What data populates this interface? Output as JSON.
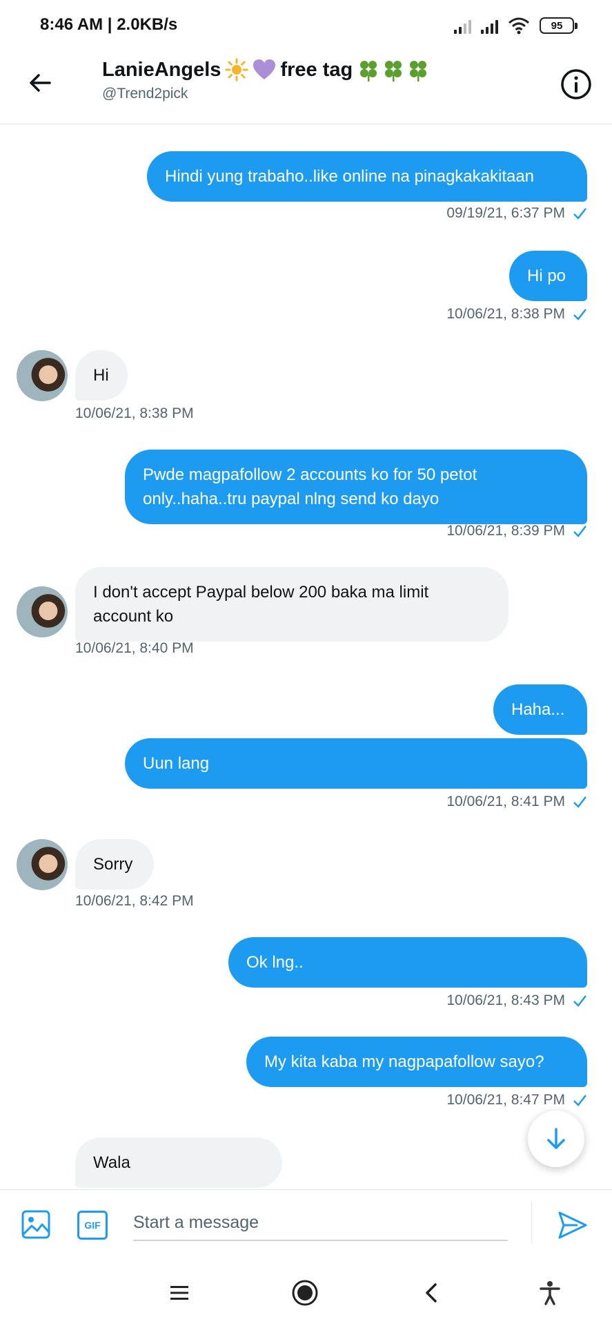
{
  "status_bar": {
    "time": "8:46 AM",
    "net_speed": "2.0KB/s",
    "battery": "95"
  },
  "header": {
    "name": "LanieAngels",
    "name_suffix": "free tag",
    "handle": "@Trend2pick"
  },
  "messages": [
    {
      "dir": "sent",
      "text": "Hindi yung trabaho..like online na pinagkakakitaan",
      "time": "09/19/21, 6:37 PM"
    },
    {
      "dir": "sent",
      "text": "Hi po",
      "time": "10/06/21, 8:38 PM"
    },
    {
      "dir": "recv",
      "text": "Hi",
      "time": "10/06/21, 8:38 PM"
    },
    {
      "dir": "sent",
      "text": "Pwde magpafollow 2 accounts ko for 50 petot only..haha..tru paypal nlng send ko dayo",
      "time": "10/06/21, 8:39 PM"
    },
    {
      "dir": "recv",
      "text": "I don't accept Paypal below 200 baka ma limit account ko",
      "time": "10/06/21, 8:40 PM"
    },
    {
      "dir": "sent",
      "text": "Haha..."
    },
    {
      "dir": "sent",
      "text": "Uun lang",
      "time": "10/06/21, 8:41 PM"
    },
    {
      "dir": "recv",
      "text": "Sorry",
      "time": "10/06/21, 8:42 PM"
    },
    {
      "dir": "sent",
      "text": "Ok lng..",
      "time": "10/06/21, 8:43 PM"
    },
    {
      "dir": "sent",
      "text": "My kita kaba my nagpapafollow sayo?",
      "time": "10/06/21, 8:47 PM"
    },
    {
      "dir": "recv",
      "text": "Wala"
    }
  ],
  "composer": {
    "placeholder": "Start a message",
    "gif_label": "GIF"
  },
  "colors": {
    "accent": "#1d9bf0",
    "received_bubble": "#eff3f4",
    "secondary_text": "#536471"
  },
  "icons": [
    "back-arrow-icon",
    "info-icon",
    "star-icon",
    "purple-heart-icon",
    "four-leaf-clover-icon",
    "read-check-icon",
    "arrow-down-icon",
    "image-icon",
    "gif-icon",
    "send-icon",
    "menu-icon",
    "home-circle-icon",
    "nav-back-icon",
    "accessibility-icon"
  ]
}
